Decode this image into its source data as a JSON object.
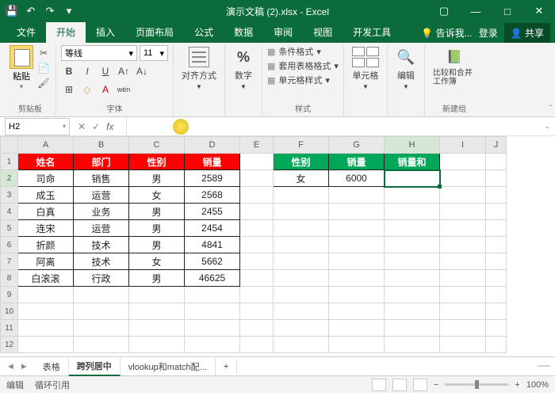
{
  "title": "演示文稿 (2).xlsx - Excel",
  "tabs": [
    "文件",
    "开始",
    "插入",
    "页面布局",
    "公式",
    "数据",
    "审阅",
    "视图",
    "开发工具"
  ],
  "tell_me": "告诉我...",
  "login": "登录",
  "share": "共享",
  "ribbon": {
    "paste": "粘贴",
    "clipboard": "剪贴板",
    "font_name": "等线",
    "font_size": "11",
    "font_group": "字体",
    "align": "对齐方式",
    "number": "数字",
    "cond_fmt": "条件格式",
    "table_fmt": "套用表格格式",
    "cell_style": "单元格样式",
    "styles": "样式",
    "cells": "单元格",
    "edit": "编辑",
    "compare": "比较和合并工作簿",
    "newgroup": "新建组"
  },
  "namebox": "H2",
  "cols": [
    "A",
    "B",
    "C",
    "D",
    "E",
    "F",
    "G",
    "H",
    "I",
    "J"
  ],
  "widths": [
    70,
    70,
    70,
    70,
    42,
    70,
    70,
    70,
    58,
    26
  ],
  "header_red": [
    "姓名",
    "部门",
    "性别",
    "销量"
  ],
  "header_grn": [
    "性别",
    "销量",
    "销量和"
  ],
  "rows": [
    [
      "司命",
      "销售",
      "男",
      "2589"
    ],
    [
      "成玉",
      "运营",
      "女",
      "2568"
    ],
    [
      "白真",
      "业务",
      "男",
      "2455"
    ],
    [
      "连宋",
      "运营",
      "男",
      "2454"
    ],
    [
      "折颜",
      "技术",
      "男",
      "4841"
    ],
    [
      "阿离",
      "技术",
      "女",
      "5662"
    ],
    [
      "白滚滚",
      "行政",
      "男",
      "46625"
    ]
  ],
  "side": {
    "f2": "女",
    "g2": "6000"
  },
  "sheets": {
    "tabs": [
      "表格",
      "跨列居中",
      "vlookup和match配..."
    ],
    "add": "+"
  },
  "status": {
    "mode": "编辑",
    "circ": "循环引用",
    "zoom": "100%"
  }
}
